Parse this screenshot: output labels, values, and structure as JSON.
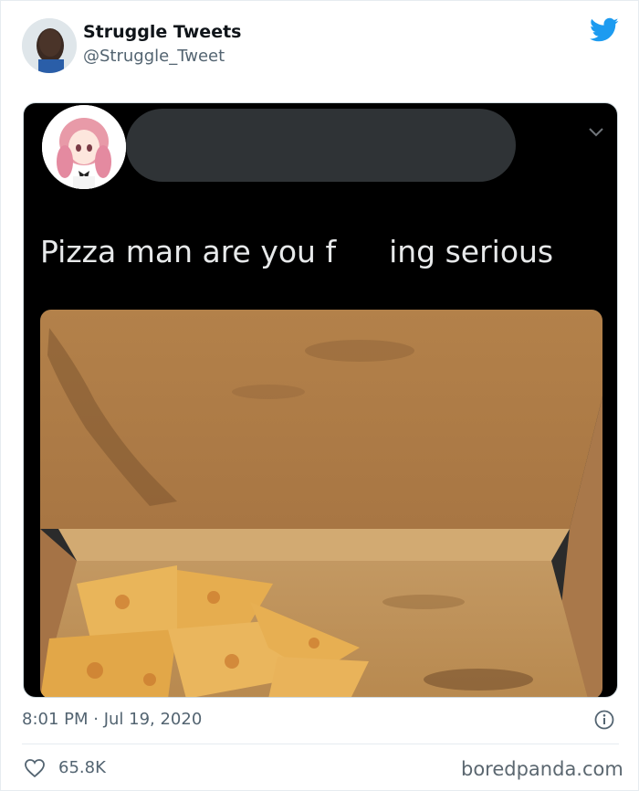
{
  "tweet": {
    "display_name": "Struggle Tweets",
    "handle": "@Struggle_Tweet",
    "timestamp": "8:01 PM · Jul 19, 2020",
    "likes": "65.8K",
    "icons": {
      "platform": "twitter-bird-icon",
      "info": "info-icon",
      "like": "heart-icon"
    }
  },
  "embedded_tweet": {
    "text_left": "Pizza man are you f",
    "text_right": "ing serious",
    "theme": "dark"
  },
  "watermark": "boredpanda.com",
  "colors": {
    "brand": "#1d9bf0",
    "muted": "#536471",
    "dark_bg": "#000000"
  }
}
